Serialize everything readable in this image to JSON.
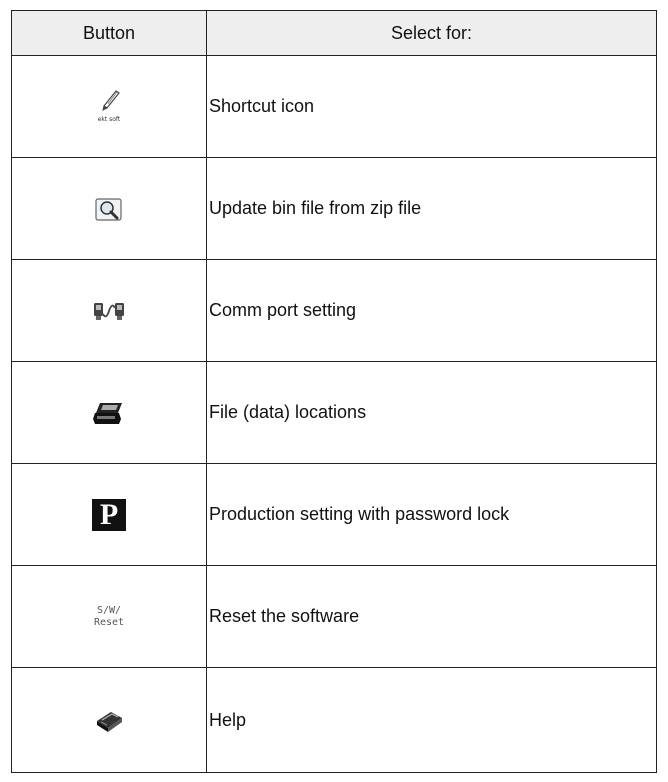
{
  "table": {
    "header": {
      "button": "Button",
      "select_for": "Select for:"
    },
    "rows": [
      {
        "icon": "shortcut-pen-icon",
        "icon_caption": "ekt soft",
        "description": "Shortcut icon"
      },
      {
        "icon": "magnifier-icon",
        "description": "Update bin file from zip file"
      },
      {
        "icon": "comm-port-icon",
        "description": "Comm port setting"
      },
      {
        "icon": "printer-icon",
        "description": "File (data) locations"
      },
      {
        "icon": "production-p-icon",
        "icon_text": "P",
        "description": "Production setting with password lock"
      },
      {
        "icon": "reset-icon",
        "icon_text_line1": "S/W/",
        "icon_text_line2": "Reset",
        "description": "Reset the software"
      },
      {
        "icon": "help-book-icon",
        "description": "Help"
      }
    ]
  }
}
